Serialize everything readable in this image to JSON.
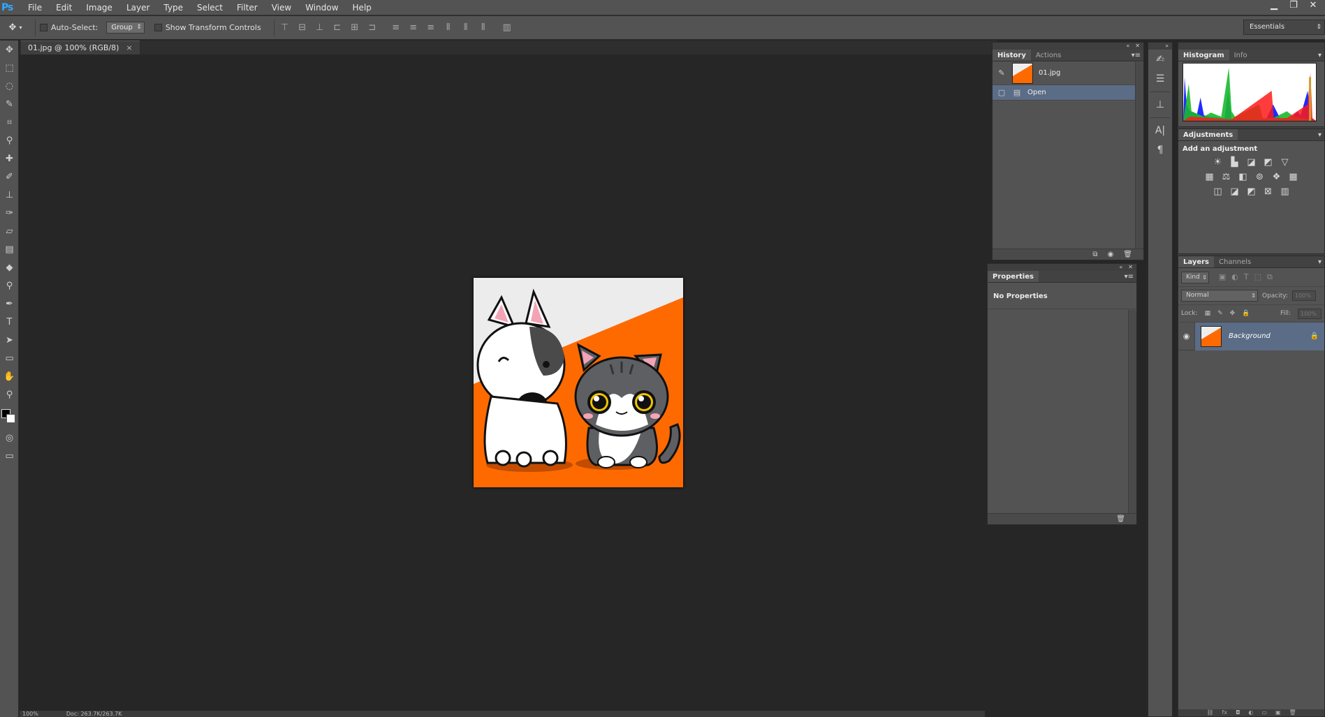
{
  "app": {
    "logo": "Ps"
  },
  "menu": [
    "File",
    "Edit",
    "Image",
    "Layer",
    "Type",
    "Select",
    "Filter",
    "View",
    "Window",
    "Help"
  ],
  "window_controls": {
    "minimize": "▁",
    "restore": "❐",
    "close": "✕"
  },
  "options": {
    "auto_select_label": "Auto-Select:",
    "auto_select_value": "Group",
    "transform_label": "Show Transform Controls",
    "workspace": "Essentials"
  },
  "document": {
    "tab_title": "01.jpg @ 100% (RGB/8)",
    "close": "×"
  },
  "history": {
    "tabs": [
      "History",
      "Actions"
    ],
    "snapshot_label": "01.jpg",
    "steps": [
      "Open"
    ]
  },
  "properties": {
    "tab": "Properties",
    "message": "No Properties"
  },
  "histogram": {
    "tabs": [
      "Histogram",
      "Info"
    ]
  },
  "adjustments": {
    "tab": "Adjustments",
    "title": "Add an adjustment"
  },
  "layers": {
    "tabs": [
      "Layers",
      "Channels"
    ],
    "filter_kind": "Kind",
    "blend_mode": "Normal",
    "opacity_label": "Opacity:",
    "opacity_value": "100%",
    "lock_label": "Lock:",
    "fill_label": "Fill:",
    "fill_value": "100%",
    "items": [
      {
        "name": "Background",
        "visible": true,
        "locked": true
      }
    ]
  },
  "status": {
    "zoom": "100%",
    "doc_info": "Doc: 263.7K/263.7K"
  },
  "colors": {
    "accent_selection": "#5b6c86",
    "orange": "#ff6a00",
    "ps_blue": "#31a8ff"
  }
}
